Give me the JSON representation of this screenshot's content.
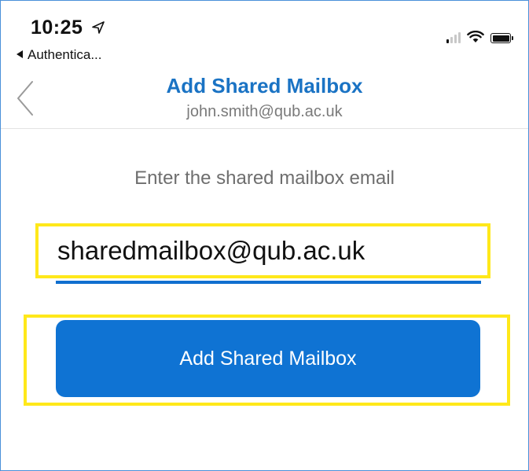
{
  "status_bar": {
    "time": "10:25",
    "location_icon": "location-arrow-icon",
    "back_to_app": "Authentica...",
    "icons": [
      "cellular-signal-icon",
      "wifi-icon",
      "battery-icon"
    ]
  },
  "nav": {
    "back_icon": "chevron-left-icon",
    "title": "Add Shared Mailbox",
    "subtitle": "john.smith@qub.ac.uk"
  },
  "form": {
    "instruction": "Enter the shared mailbox email",
    "email_value": "sharedmailbox@qub.ac.uk",
    "submit_label": "Add Shared Mailbox"
  },
  "colors": {
    "accent": "#0f73d3",
    "title": "#1a73c4",
    "highlight": "#ffe81a"
  }
}
